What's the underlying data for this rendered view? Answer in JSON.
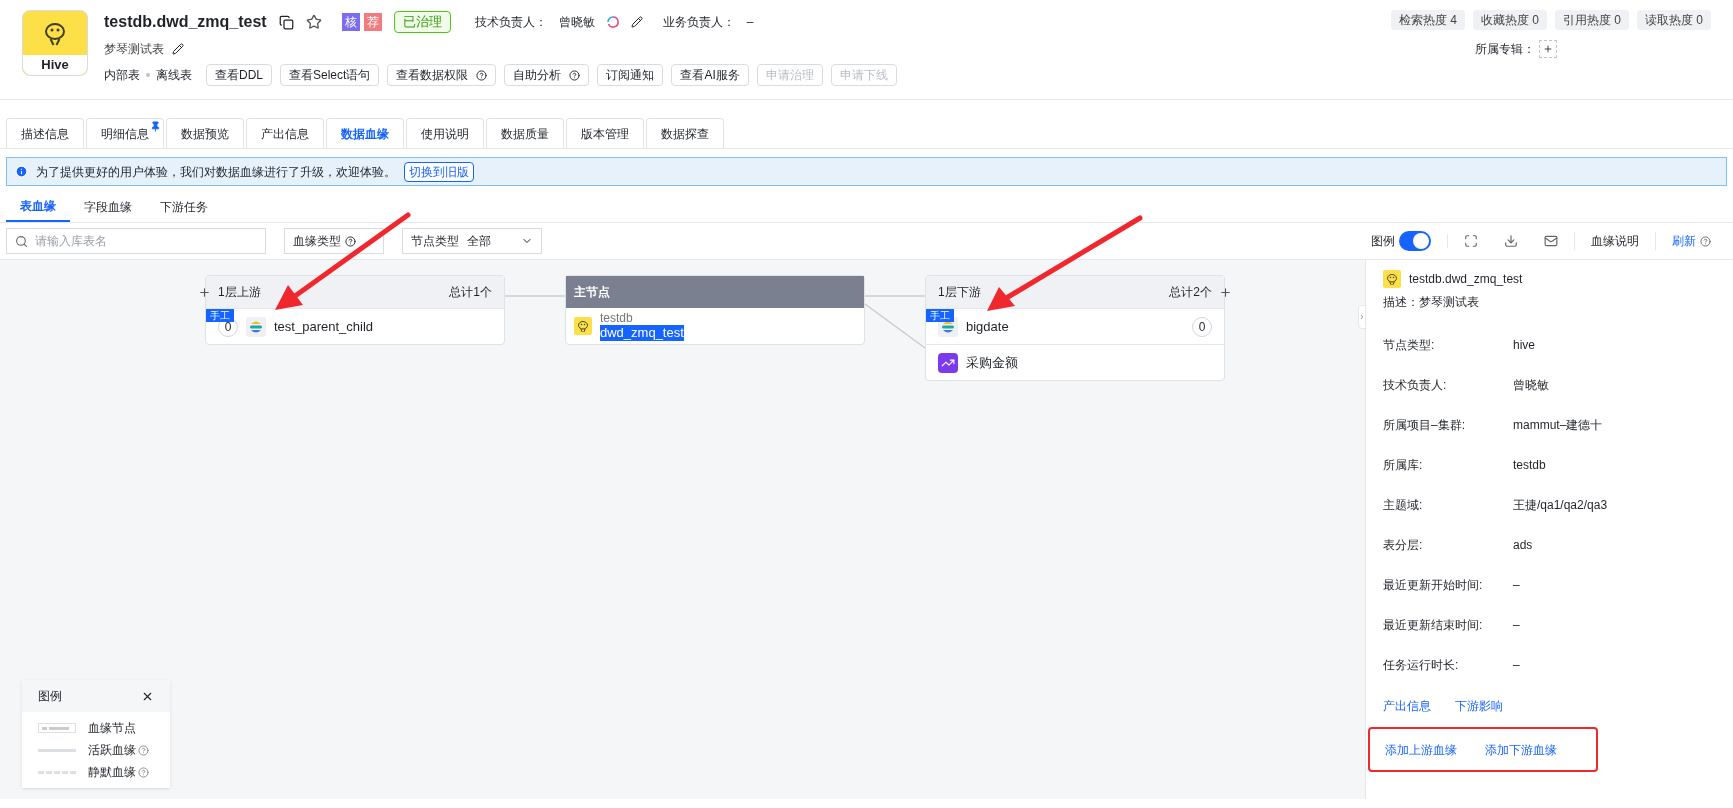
{
  "header": {
    "logo_label": "Hive",
    "title": "testdb.dwd_zmq_test",
    "badges": [
      {
        "text": "核",
        "color": "#7b6cf0"
      },
      {
        "text": "荐",
        "color": "#f27b80"
      }
    ],
    "status": "已治理",
    "tech_owner_label": "技术负责人：",
    "tech_owner": "曾晓敏",
    "biz_owner_label": "业务负责人：",
    "biz_owner": "–",
    "description": "梦琴测试表",
    "tags": [
      "内部表",
      "离线表"
    ],
    "buttons": [
      {
        "label": "查看DDL",
        "help": false,
        "disabled": false
      },
      {
        "label": "查看Select语句",
        "help": false,
        "disabled": false
      },
      {
        "label": "查看数据权限",
        "help": true,
        "disabled": false
      },
      {
        "label": "自助分析",
        "help": true,
        "disabled": false
      },
      {
        "label": "订阅通知",
        "help": false,
        "disabled": false
      },
      {
        "label": "查看AI服务",
        "help": false,
        "disabled": false
      },
      {
        "label": "申请治理",
        "help": false,
        "disabled": true
      },
      {
        "label": "申请下线",
        "help": false,
        "disabled": true
      }
    ],
    "stats": [
      "检索热度 4",
      "收藏热度 0",
      "引用热度 0",
      "读取热度 0"
    ],
    "album_label": "所属专辑："
  },
  "tabs": [
    {
      "label": "描述信息",
      "selected": false,
      "pinned": false
    },
    {
      "label": "明细信息",
      "selected": false,
      "pinned": true
    },
    {
      "label": "数据预览",
      "selected": false,
      "pinned": false
    },
    {
      "label": "产出信息",
      "selected": false,
      "pinned": false
    },
    {
      "label": "数据血缘",
      "selected": true,
      "pinned": false
    },
    {
      "label": "使用说明",
      "selected": false,
      "pinned": false
    },
    {
      "label": "数据质量",
      "selected": false,
      "pinned": false
    },
    {
      "label": "版本管理",
      "selected": false,
      "pinned": false
    },
    {
      "label": "数据探查",
      "selected": false,
      "pinned": false
    }
  ],
  "notice": {
    "text": "为了提供更好的用户体验，我们对数据血缘进行了升级，欢迎体验。",
    "link": "切换到旧版"
  },
  "sub_tabs": [
    {
      "label": "表血缘",
      "selected": true
    },
    {
      "label": "字段血缘",
      "selected": false
    },
    {
      "label": "下游任务",
      "selected": false
    }
  ],
  "toolbar": {
    "search_placeholder": "请输入库表名",
    "lineage_type_label": "血缘类型",
    "node_type_label": "节点类型",
    "node_type_value": "全部",
    "legend_label": "图例",
    "legend_on": true,
    "explain": "血缘说明",
    "refresh": "刷新"
  },
  "graph": {
    "upstream": {
      "title": "1层上游",
      "total": "总计1个",
      "items": [
        {
          "kind": "table",
          "name": "test_parent_child",
          "tag": "手工",
          "count": "0"
        }
      ]
    },
    "main": {
      "title": "主节点",
      "db": "testdb",
      "name": "dwd_zmq_test"
    },
    "downstream": {
      "title": "1层下游",
      "total": "总计2个",
      "items": [
        {
          "kind": "table",
          "name": "bigdate",
          "tag": "手工",
          "count": "0"
        },
        {
          "kind": "metric",
          "name": "采购金额"
        }
      ]
    }
  },
  "legend": {
    "title": "图例",
    "items": [
      {
        "kind": "node",
        "label": "血缘节点",
        "help": false
      },
      {
        "kind": "solid",
        "label": "活跃血缘",
        "help": true
      },
      {
        "kind": "dashed",
        "label": "静默血缘",
        "help": true
      }
    ]
  },
  "details": {
    "title": "testdb.dwd_zmq_test",
    "description_label": "描述：",
    "description": "梦琴测试表",
    "fields": [
      {
        "label": "节点类型:",
        "value": "hive"
      },
      {
        "label": "技术负责人:",
        "value": "曾晓敏"
      },
      {
        "label": "所属项目–集群:",
        "value": "mammut–建德十"
      },
      {
        "label": "所属库:",
        "value": "testdb"
      },
      {
        "label": "主题域:",
        "value": "王捷/qa1/qa2/qa3"
      },
      {
        "label": "表分层:",
        "value": "ads"
      },
      {
        "label": "最近更新开始时间:",
        "value": "–"
      },
      {
        "label": "最近更新结束时间:",
        "value": "–"
      },
      {
        "label": "任务运行时长:",
        "value": "–"
      }
    ],
    "links": [
      "产出信息",
      "下游影响"
    ],
    "add_links": [
      "添加上游血缘",
      "添加下游血缘"
    ]
  }
}
